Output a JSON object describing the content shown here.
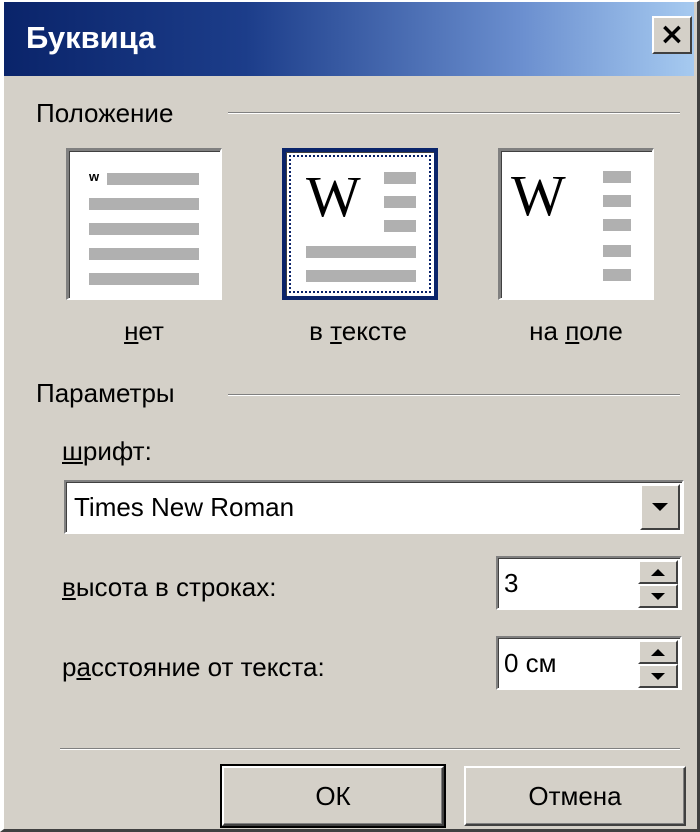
{
  "window": {
    "title": "Буквица",
    "close_label": "×"
  },
  "position_group": {
    "label": "Положение",
    "options": [
      {
        "id": "none",
        "label_pre": "",
        "label_hot": "н",
        "label_post": "ет",
        "selected": false
      },
      {
        "id": "in_text",
        "label_pre": "в ",
        "label_hot": "т",
        "label_post": "ексте",
        "selected": true
      },
      {
        "id": "in_margin",
        "label_pre": "на ",
        "label_hot": "п",
        "label_post": "оле",
        "selected": false
      }
    ],
    "preview_glyph": "W",
    "preview_small_glyph": "w"
  },
  "params_group": {
    "label": "Параметры",
    "font": {
      "label_hot": "ш",
      "label_post": "рифт:",
      "value": "Times New Roman"
    },
    "lines": {
      "label_hot": "в",
      "label_post": "ысота в строках:",
      "value": "3"
    },
    "distance": {
      "label_pre": "р",
      "label_hot": "а",
      "label_post": "сстояние от текста:",
      "value": "0 см"
    }
  },
  "buttons": {
    "ok": "ОК",
    "cancel": "Отмена"
  }
}
